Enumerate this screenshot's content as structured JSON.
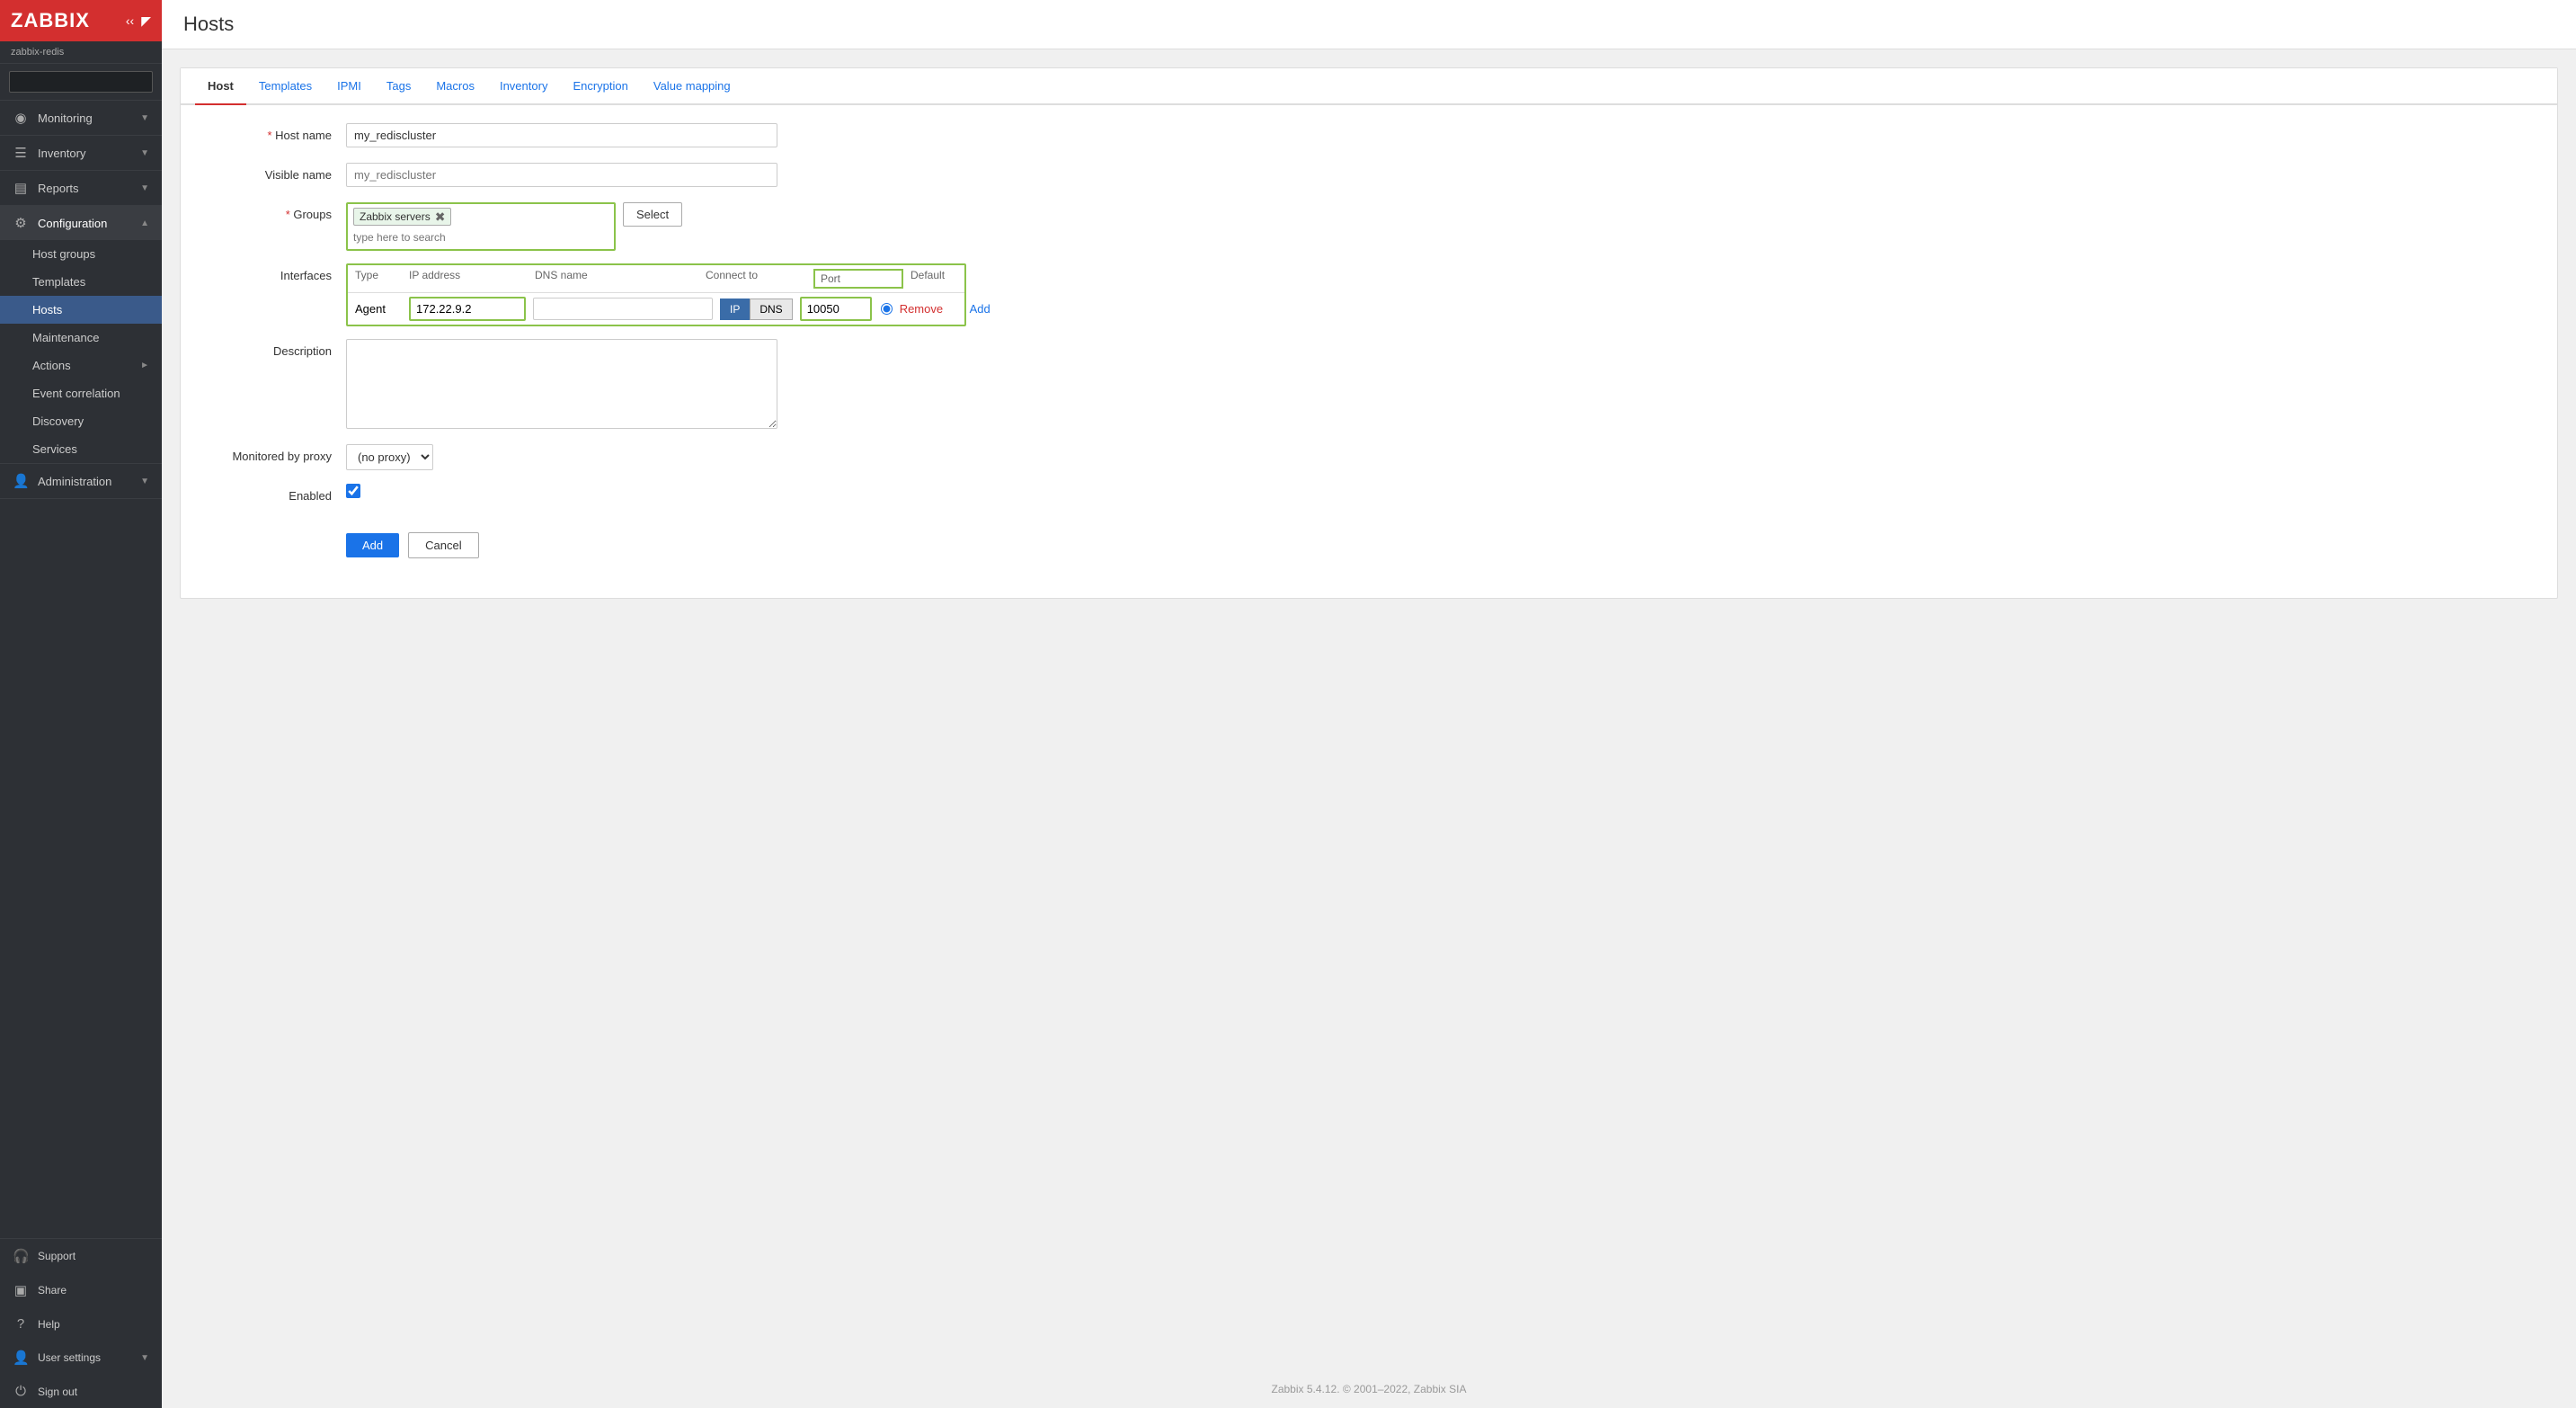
{
  "sidebar": {
    "logo": "ZABBIX",
    "user": "zabbix-redis",
    "search_placeholder": "",
    "nav": [
      {
        "label": "Monitoring",
        "icon": "◉",
        "has_arrow": true,
        "sub": []
      },
      {
        "label": "Inventory",
        "icon": "☰",
        "has_arrow": true,
        "sub": []
      },
      {
        "label": "Reports",
        "icon": "📊",
        "has_arrow": true,
        "sub": []
      },
      {
        "label": "Configuration",
        "icon": "⚙",
        "has_arrow": true,
        "expanded": true,
        "sub": [
          {
            "label": "Host groups",
            "active": false
          },
          {
            "label": "Templates",
            "active": false
          },
          {
            "label": "Hosts",
            "active": true
          },
          {
            "label": "Maintenance",
            "active": false
          },
          {
            "label": "Actions",
            "active": false,
            "has_arrow": true
          },
          {
            "label": "Event correlation",
            "active": false
          },
          {
            "label": "Discovery",
            "active": false
          },
          {
            "label": "Services",
            "active": false
          }
        ]
      },
      {
        "label": "Administration",
        "icon": "👤",
        "has_arrow": true,
        "sub": []
      }
    ],
    "bottom": [
      {
        "label": "Support",
        "icon": "🎧"
      },
      {
        "label": "Share",
        "icon": "🔲"
      },
      {
        "label": "Help",
        "icon": "?"
      },
      {
        "label": "User settings",
        "icon": "👤",
        "has_arrow": true
      },
      {
        "label": "Sign out",
        "icon": "⏻"
      }
    ]
  },
  "page": {
    "title": "Hosts"
  },
  "tabs": [
    {
      "label": "Host",
      "active": true
    },
    {
      "label": "Templates",
      "active": false
    },
    {
      "label": "IPMI",
      "active": false
    },
    {
      "label": "Tags",
      "active": false
    },
    {
      "label": "Macros",
      "active": false
    },
    {
      "label": "Inventory",
      "active": false
    },
    {
      "label": "Encryption",
      "active": false
    },
    {
      "label": "Value mapping",
      "active": false
    }
  ],
  "form": {
    "host_name_label": "Host name",
    "host_name_value": "my_rediscluster",
    "visible_name_label": "Visible name",
    "visible_name_placeholder": "my_rediscluster",
    "groups_label": "Groups",
    "groups_tag": "Zabbix servers",
    "groups_search_placeholder": "type here to search",
    "select_button": "Select",
    "interfaces_label": "Interfaces",
    "iface_col_type": "Type",
    "iface_col_ip": "IP address",
    "iface_col_dns": "DNS name",
    "iface_col_connect": "Connect to",
    "iface_col_port": "Port",
    "iface_col_default": "Default",
    "iface_type": "Agent",
    "iface_ip": "172.22.9.2",
    "iface_dns": "",
    "iface_port": "10050",
    "iface_btn_ip": "IP",
    "iface_btn_dns": "DNS",
    "iface_remove": "Remove",
    "add_link": "Add",
    "description_label": "Description",
    "proxy_label": "Monitored by proxy",
    "proxy_value": "(no proxy)",
    "enabled_label": "Enabled",
    "add_button": "Add",
    "cancel_button": "Cancel"
  },
  "footer": {
    "text": "Zabbix 5.4.12. © 2001–2022, Zabbix SIA"
  }
}
